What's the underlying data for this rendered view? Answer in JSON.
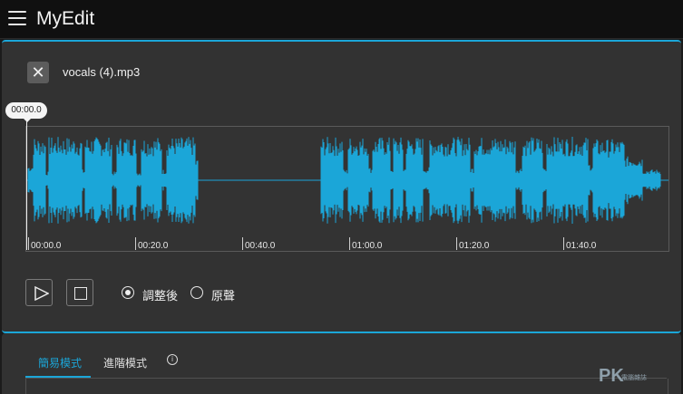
{
  "app": {
    "title": "MyEdit"
  },
  "file": {
    "name": "vocals (4).mp3",
    "close_symbol": "✕"
  },
  "playhead": {
    "time": "00:00.0"
  },
  "timeline": {
    "labels": [
      "00:00.0",
      "00:20.0",
      "00:40.0",
      "01:00.0",
      "01:20.0",
      "01:40.0"
    ],
    "waveform_color": "#1ba6d8"
  },
  "playback": {
    "play_icon": "play-icon",
    "stop_icon": "stop-icon",
    "options": [
      {
        "label": "調整後",
        "selected": true
      },
      {
        "label": "原聲",
        "selected": false
      }
    ]
  },
  "tabs": [
    {
      "label": "簡易模式",
      "active": true
    },
    {
      "label": "進階模式",
      "active": false
    }
  ],
  "info_symbol": "i",
  "watermark": {
    "logo": "PK",
    "text": "電腦雜誌"
  },
  "colors": {
    "accent": "#1ba6d8",
    "background": "#1b1b1b",
    "panel": "#323232"
  }
}
